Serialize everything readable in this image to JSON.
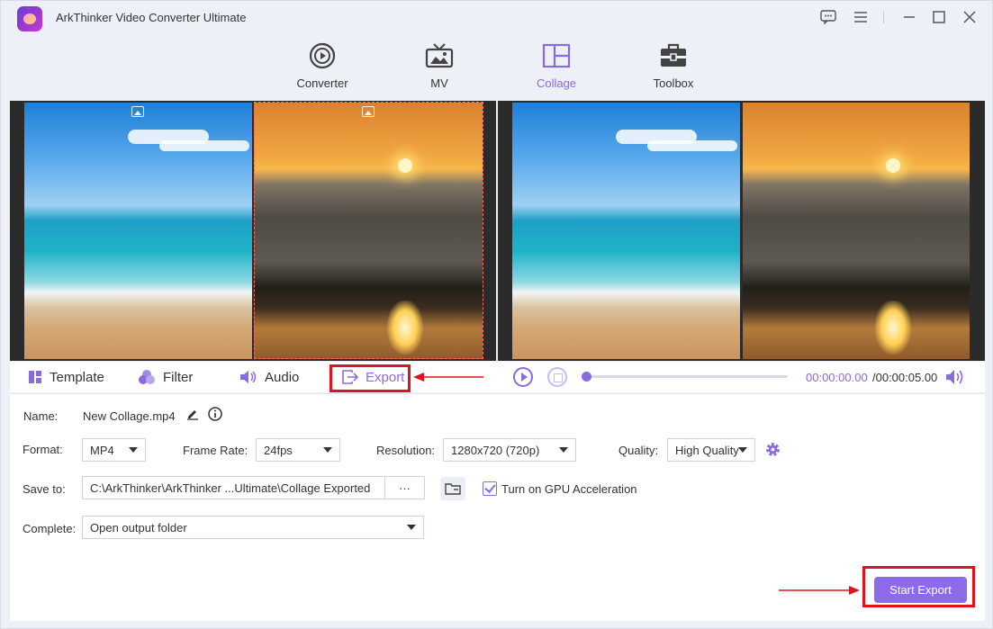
{
  "app": {
    "title": "ArkThinker Video Converter Ultimate"
  },
  "window_controls": {
    "icons": [
      "feedback-icon",
      "menu-icon",
      "minimize-icon",
      "maximize-icon",
      "close-icon"
    ]
  },
  "nav": {
    "tabs": [
      {
        "label": "Converter",
        "icon": "converter-icon"
      },
      {
        "label": "MV",
        "icon": "tv-icon"
      },
      {
        "label": "Collage",
        "icon": "collage-icon",
        "active": true
      },
      {
        "label": "Toolbox",
        "icon": "toolbox-icon"
      }
    ]
  },
  "edit_tabs": {
    "template": "Template",
    "filter": "Filter",
    "audio": "Audio",
    "export": "Export",
    "active": "export"
  },
  "playback": {
    "time_current": "00:00:00.00",
    "time_total": "/00:00:05.00",
    "progress": 0.0
  },
  "settings": {
    "name_label": "Name:",
    "name_value": "New Collage.mp4",
    "format_label": "Format:",
    "format_value": "MP4",
    "framerate_label": "Frame Rate:",
    "framerate_value": "24fps",
    "resolution_label": "Resolution:",
    "resolution_value": "1280x720 (720p)",
    "quality_label": "Quality:",
    "quality_value": "High Quality",
    "saveto_label": "Save to:",
    "saveto_value": "C:\\ArkThinker\\ArkThinker ...Ultimate\\Collage Exported",
    "browse_label": "···",
    "gpu_label": "Turn on GPU Acceleration",
    "gpu_checked": true,
    "complete_label": "Complete:",
    "complete_value": "Open output folder"
  },
  "actions": {
    "start_export": "Start Export"
  },
  "colors": {
    "accent": "#8a6ae0",
    "highlight": "#e0121c",
    "button": "#8d6be8"
  }
}
